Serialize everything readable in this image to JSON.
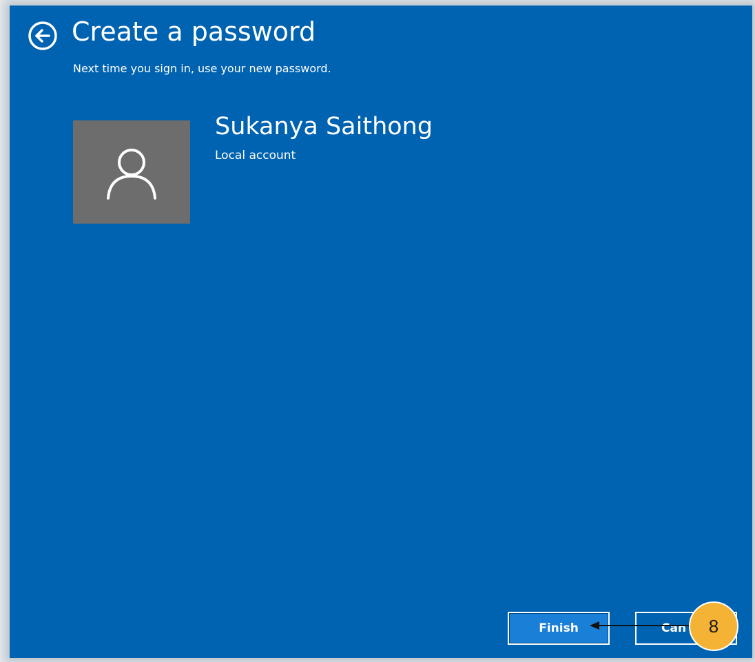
{
  "header": {
    "title": "Create a password",
    "subtitle": "Next time you sign in, use your new password."
  },
  "account": {
    "name": "Sukanya Saithong",
    "type": "Local account",
    "avatar_icon": "user-icon"
  },
  "navigation": {
    "back_icon": "arrow-left-circle-icon"
  },
  "buttons": {
    "finish_label": "Finish",
    "cancel_label": "Can"
  },
  "annotation": {
    "step": "8"
  },
  "colors": {
    "background": "#0063b1",
    "avatar_bg": "#6d6d6d",
    "callout": "#f5b335",
    "text": "#ffffff"
  }
}
